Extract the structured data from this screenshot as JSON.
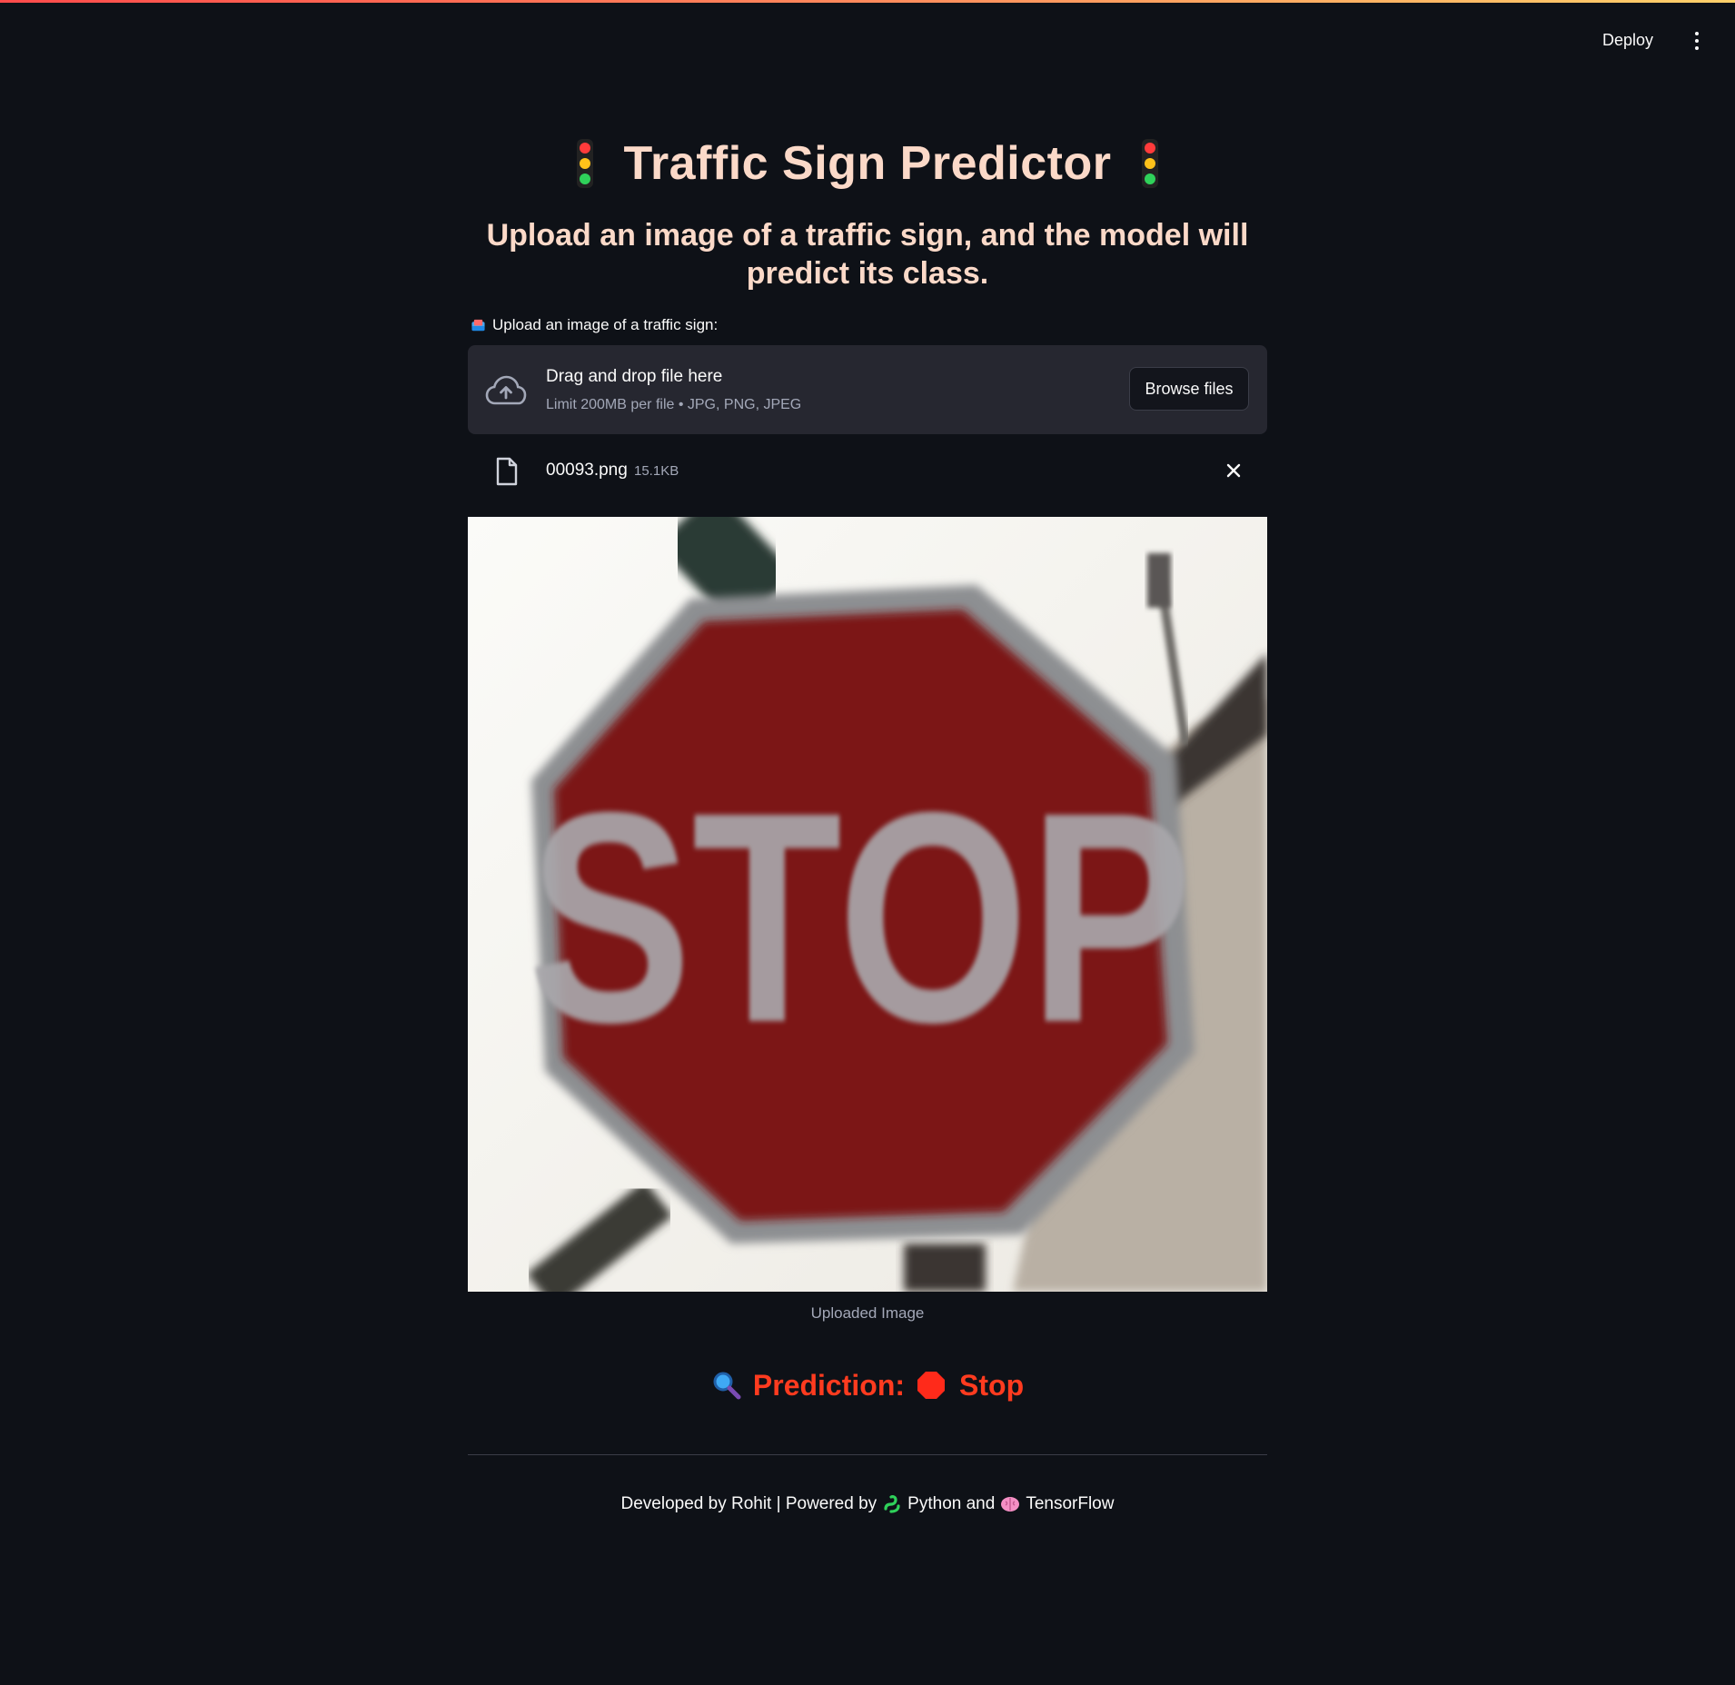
{
  "header": {
    "deploy_label": "Deploy",
    "menu_icon": "kebab-menu-icon"
  },
  "app": {
    "title": "Traffic Sign Predictor",
    "title_icon": "traffic-light-icon",
    "subtitle": "Upload an image of a traffic sign, and the model will predict its class."
  },
  "uploader": {
    "label": "Upload an image of a traffic sign:",
    "label_icon": "inbox-tray-icon",
    "drop_title": "Drag and drop file here",
    "drop_limit": "Limit 200MB per file • JPG, PNG, JPEG",
    "browse_label": "Browse files",
    "upload_icon": "cloud-upload-icon"
  },
  "uploaded_file": {
    "name": "00093.png",
    "size": "15.1KB",
    "file_icon": "file-icon",
    "remove_icon": "close-icon"
  },
  "image": {
    "sign_text": "STOP",
    "caption": "Uploaded Image"
  },
  "prediction": {
    "label": "Prediction:",
    "value": "Stop",
    "icon": "magnifier-icon",
    "value_icon": "stop-sign-icon",
    "color": "#ff3b1f"
  },
  "footer": {
    "developed": "Developed by Rohit | Powered by",
    "python": "Python and",
    "tensorflow": "TensorFlow",
    "python_icon": "snake-icon",
    "tf_icon": "brain-icon"
  },
  "colors": {
    "background": "#0e1117",
    "title": "#fbd9c8",
    "panel": "#262730",
    "accent": "#ff4b4b"
  }
}
